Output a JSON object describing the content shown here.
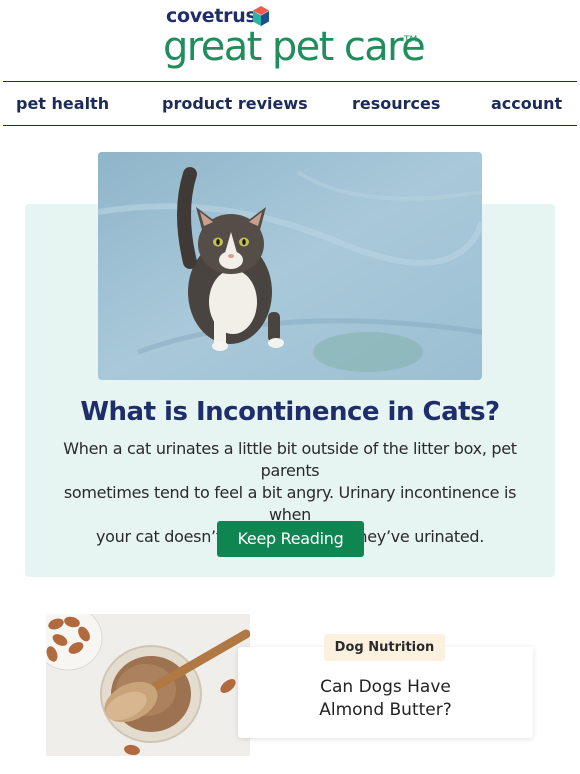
{
  "brand": {
    "parent": "covetrus",
    "name": "great pet care",
    "trademark": "TM"
  },
  "nav": {
    "items": [
      {
        "label": "pet health"
      },
      {
        "label": "product reviews"
      },
      {
        "label": "resources"
      },
      {
        "label": "account"
      }
    ]
  },
  "feature": {
    "image_icon": "cat-on-bed-photo",
    "title": "What is Incontinence in Cats?",
    "description_lines": [
      "When a cat urinates a little bit outside of the litter box, pet parents",
      "sometimes tend to feel a bit angry. Urinary incontinence is when",
      "your cat doesn’t even know that they’ve urinated."
    ],
    "button_label": "Keep Reading"
  },
  "article": {
    "image_icon": "almond-butter-photo",
    "category": "Dog Nutrition",
    "title_lines": [
      "Can Dogs Have",
      "Almond Butter?"
    ]
  },
  "colors": {
    "brand_green": "#1f8e5c",
    "brand_navy": "#1f2d6b",
    "button_green": "#0f8552",
    "feature_bg": "#e6f4f2",
    "badge_bg": "#fbf1de"
  }
}
